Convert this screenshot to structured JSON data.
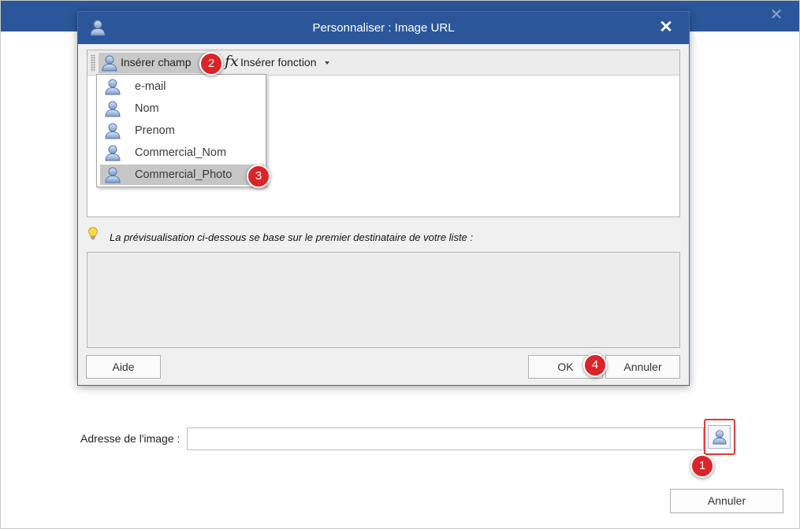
{
  "outer": {
    "close_symbol": "✕",
    "address_label": "Adresse de l'image :",
    "address_value": "",
    "cancel_label": "Annuler"
  },
  "dialog": {
    "title": "Personnaliser : Image URL",
    "close_symbol": "✕",
    "toolbar": {
      "insert_field_label": "Insérer champ",
      "insert_function_icon": "fx",
      "insert_function_label": "Insérer fonction"
    },
    "fields_menu": {
      "items": [
        {
          "label": "e-mail",
          "selected": false
        },
        {
          "label": "Nom",
          "selected": false
        },
        {
          "label": "Prenom",
          "selected": false
        },
        {
          "label": "Commercial_Nom",
          "selected": false
        },
        {
          "label": "Commercial_Photo",
          "selected": true
        }
      ]
    },
    "preview_hint": "La prévisualisation ci-dessous se base sur le premier destinataire de votre liste :",
    "help_label": "Aide",
    "ok_label": "OK",
    "cancel_label": "Annuler"
  },
  "badges": [
    "1",
    "2",
    "3",
    "4"
  ],
  "icons": {
    "user": "user-icon",
    "function": "function-icon",
    "lightbulb": "lightbulb-icon",
    "close": "close-icon"
  },
  "colors": {
    "title_bar": "#2b579a",
    "badge": "#d9242a",
    "highlight_frame": "#e03a3a"
  }
}
